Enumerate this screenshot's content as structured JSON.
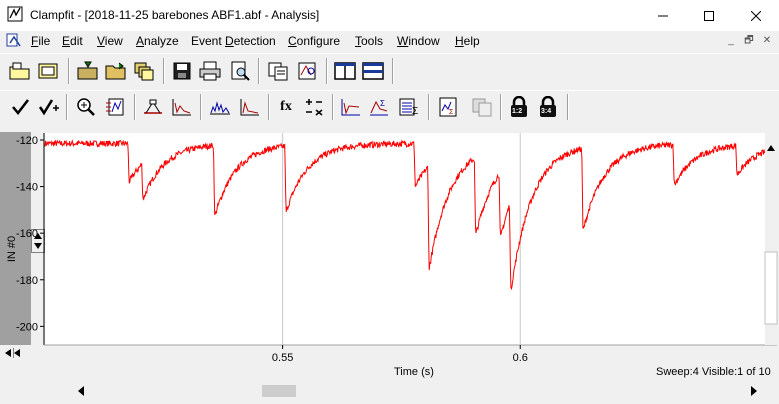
{
  "window": {
    "title": "Clampfit - [2018-11-25 barebones ABF1.abf - Analysis]",
    "minimize_glyph": "—",
    "maximize_glyph": "☐",
    "close_glyph": "✕"
  },
  "menu": {
    "items": [
      {
        "key": "F",
        "rest": "ile"
      },
      {
        "key": "E",
        "rest": "dit"
      },
      {
        "key": "V",
        "rest": "iew"
      },
      {
        "key": "A",
        "rest": "nalyze"
      },
      {
        "pre": "Event ",
        "key": "D",
        "rest": "etection"
      },
      {
        "key": "C",
        "rest": "onfigure"
      },
      {
        "key": "T",
        "rest": "ools"
      },
      {
        "key": "W",
        "rest": "indow"
      },
      {
        "key": "H",
        "rest": "elp"
      }
    ],
    "mdi_minimize": "_",
    "mdi_restore": "🗗",
    "mdi_close": "✕"
  },
  "toolbar1": {
    "icons": [
      "open-data-icon",
      "open-other-icon",
      "save-as-icon",
      "open-folder-icon",
      "windows-icon",
      "save-icon",
      "print-icon",
      "print-preview-icon",
      "copy-icon",
      "zoom-chart-icon",
      "split-horizontal-icon",
      "split-vertical-icon"
    ]
  },
  "toolbar2": {
    "icons": [
      "accept-icon",
      "accept-all-icon",
      "zoom-icon",
      "scale-icon",
      "baseline-icon",
      "fit-icon",
      "histogram-icon",
      "distribution-icon",
      "function-icon",
      "arithmetic-icon",
      "event-template-icon",
      "event-peak-icon",
      "statistics-icon",
      "data-stats-icon",
      "disabled-icon",
      "lock-1-2-icon",
      "lock-3-4-icon"
    ],
    "fx_label": "fx",
    "lock1_label": "1:2",
    "lock2_label": "3:4"
  },
  "chart": {
    "channel_label": "IN #0",
    "x_axis_label": "Time (s)",
    "status_text": "Sweep:4 Visible:1 of 10",
    "trace_color": "#ff0000",
    "grid_color": "#c8c8c8"
  },
  "chart_data": {
    "type": "line",
    "title": "",
    "xlabel": "Time (s)",
    "ylabel": "IN #0",
    "xlim": [
      0.5,
      0.6515
    ],
    "ylim": [
      -208,
      -117
    ],
    "x_ticks": [
      0.55,
      0.6
    ],
    "x_tick_labels": [
      "0.55",
      "0.6"
    ],
    "y_ticks": [
      -120,
      -140,
      -160,
      -180,
      -200
    ],
    "y_tick_labels": [
      "-120",
      "-140",
      "-160",
      "-180",
      "-200"
    ],
    "baseline": -121.5,
    "events": [
      {
        "t": 0.5177,
        "peak": -138
      },
      {
        "t": 0.5206,
        "peak": -137
      },
      {
        "t": 0.5357,
        "peak": -152
      },
      {
        "t": 0.5507,
        "peak": -150
      },
      {
        "t": 0.5779,
        "peak": -140
      },
      {
        "t": 0.5808,
        "peak": -166
      },
      {
        "t": 0.5906,
        "peak": -155
      },
      {
        "t": 0.5958,
        "peak": -150
      },
      {
        "t": 0.598,
        "peak": -160
      },
      {
        "t": 0.6132,
        "peak": -157
      },
      {
        "t": 0.6324,
        "peak": -139
      },
      {
        "t": 0.6456,
        "peak": -134
      }
    ]
  }
}
